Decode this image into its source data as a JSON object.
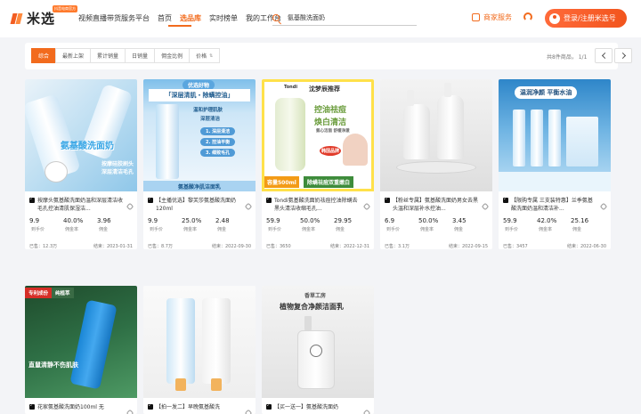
{
  "header": {
    "logo_text": "米选",
    "logo_tag": "抖音电商官方",
    "nav": [
      "视频直播带货服务平台",
      "首页",
      "选品库",
      "实时榜单",
      "我的工作台"
    ],
    "nav_active": "选品库",
    "search_value": "氨基酸洗面奶",
    "merchant_label": "商家服务",
    "login_label": "登录/注册米选号"
  },
  "filters": {
    "tabs": [
      {
        "label": "综合",
        "active": true
      },
      {
        "label": "最新上架",
        "caret": false
      },
      {
        "label": "累计销量",
        "caret": false
      },
      {
        "label": "日销量",
        "caret": false
      },
      {
        "label": "佣金比例",
        "caret": false
      },
      {
        "label": "价格",
        "caret": true
      }
    ],
    "total_text": "共8件商品， 1/1"
  },
  "stat_labels": [
    "到手价",
    "佣金率",
    "佣金"
  ],
  "products": [
    {
      "title": "按摩头氨基酸洗面奶温和深层清洁收毛孔控油清肌保湿洁...",
      "price": "9.9",
      "rate": "40.0%",
      "commission": "3.96",
      "sold": "已售：12.3万",
      "end": "结束：2023-01-31",
      "img_text": [
        "氨基酸洗面奶",
        "按摩硅胶刷头",
        "深层清洁毛孔"
      ]
    },
    {
      "title": "【主播优选】黎芙莎氨基酸洗面奶120ml",
      "price": "9.9",
      "rate": "25.0%",
      "commission": "2.48",
      "sold": "已售：8.7万",
      "end": "结束：2022-09-30",
      "img_text": [
        "优选好物",
        "「深层清肌・除螨控油」",
        "温和护理肌肤",
        "深层清洁",
        "1. 深层清洁",
        "2. 控油平衡",
        "3. 细致毛孔",
        "氨基酸净肌洁面乳"
      ]
    },
    {
      "title": "Tondi氨基酸洗面奶祛痘控油除螨去黑头清洁收缩毛孔...",
      "price": "59.9",
      "rate": "50.0%",
      "commission": "29.95",
      "sold": "已售：3650",
      "end": "结束：2022-12-31",
      "img_text": [
        "Tondi",
        "沈梦辰推荐",
        "控油祛痘",
        "焕白清洁",
        "氨心洁面 舒缓净澈",
        "韩国品牌",
        "容量500ml",
        "除螨祛痘双重嫩白"
      ]
    },
    {
      "title": "【粉丝专属】氨基酸洗面奶男女去黑头温和深层补水控油...",
      "price": "6.9",
      "rate": "50.0%",
      "commission": "3.45",
      "sold": "已售：3.1万",
      "end": "结束：2022-09-15",
      "img_text": []
    },
    {
      "title": "【限购专属 三支装特惠】兰季氨基酸洗面奶温和清洁补...",
      "price": "59.9",
      "rate": "42.0%",
      "commission": "25.16",
      "sold": "已售：3457",
      "end": "结束：2022-06-30",
      "img_text": [
        "温润净颜 平衡水油"
      ]
    },
    {
      "title": "花家氨基酸洗面奶100ml 无",
      "img_text": [
        "专利成份",
        "纯植萃",
        "直鼠清静不伤肌肤"
      ]
    },
    {
      "title": "【拍一发二】早晚氨基酸洗",
      "img_text": []
    },
    {
      "title": "【买一送一】氨基酸洗面奶",
      "img_text": [
        "香草工房",
        "植物复合净颜洁面乳"
      ]
    }
  ],
  "colors": {
    "accent": "#f26b1d",
    "page_bg": "#f3f4f7"
  }
}
